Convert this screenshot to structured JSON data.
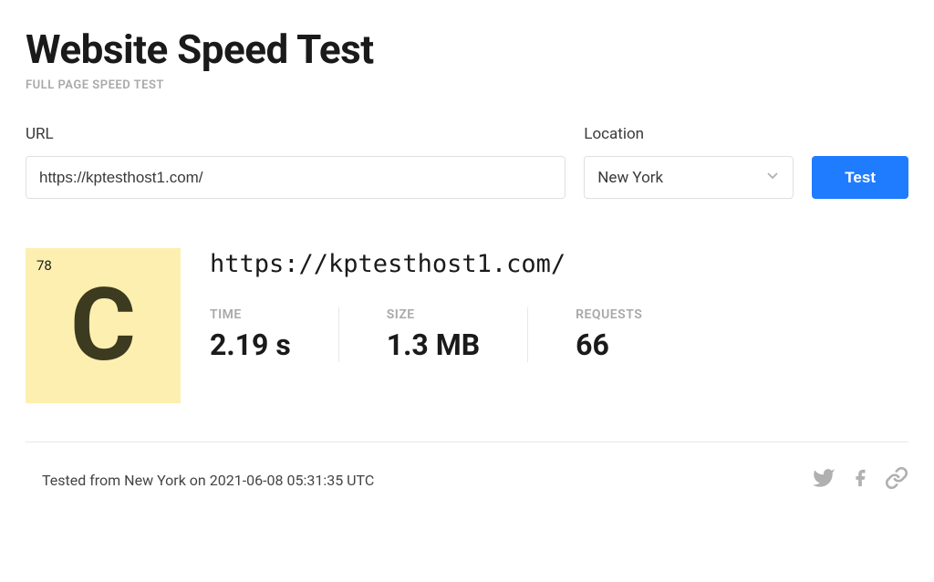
{
  "header": {
    "title": "Website Speed Test",
    "subtitle": "FULL PAGE SPEED TEST"
  },
  "form": {
    "url_label": "URL",
    "url_value": "https://kptesthost1.com/",
    "location_label": "Location",
    "location_selected": "New York",
    "test_button": "Test"
  },
  "results": {
    "score": "78",
    "grade": "C",
    "tested_url": "https://kptesthost1.com/",
    "stats": {
      "time_label": "TIME",
      "time_value": "2.19 s",
      "size_label": "SIZE",
      "size_value": "1.3 MB",
      "requests_label": "REQUESTS",
      "requests_value": "66"
    }
  },
  "footer": {
    "tested_info": "Tested from New York on 2021-06-08 05:31:35 UTC"
  }
}
